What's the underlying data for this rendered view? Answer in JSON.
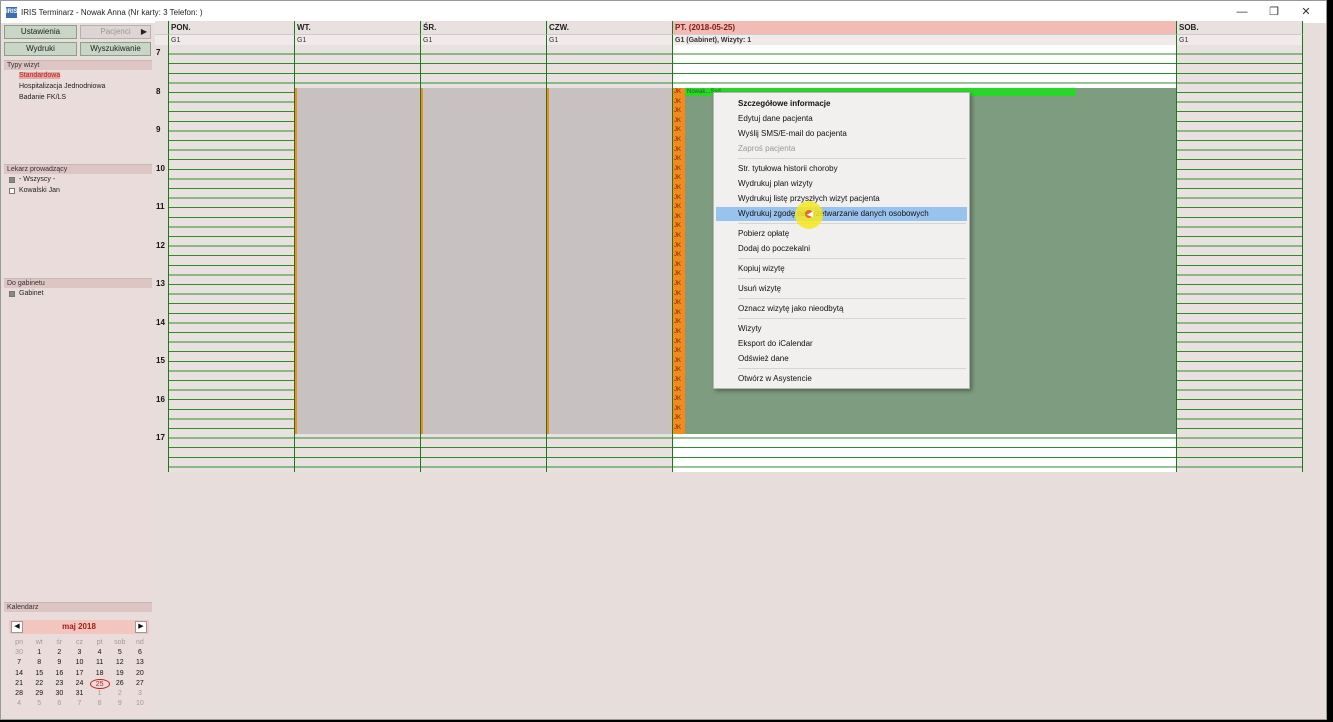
{
  "window": {
    "title": "IRIS Terminarz - Nowak Anna (Nr karty: 3  Telefon: )",
    "icon_text": "IRIS",
    "minimize_glyph": "—",
    "maximize_glyph": "❐",
    "close_glyph": "✕"
  },
  "toolbar": {
    "settings_label": "Ustawienia",
    "patients_label": "Pacjenci",
    "patients_arrow": "▶",
    "prints_label": "Wydruki",
    "search_label": "Wyszukiwanie"
  },
  "visit_types": {
    "header": "Typy wizyt",
    "items": [
      "Standardowa",
      "Hospitalizacja Jednodniowa",
      "Badanie FK/LS"
    ]
  },
  "doctors": {
    "header": "Lekarz prowadzący",
    "items": [
      "- Wszyscy -",
      "Kowalski Jan"
    ]
  },
  "offices": {
    "header": "Do gabinetu",
    "items": [
      "Gabinet"
    ]
  },
  "calendar": {
    "header": "Kalendarz",
    "month": "maj 2018",
    "prev": "◀",
    "next": "▶",
    "weekdays": [
      "pn",
      "wt",
      "śr",
      "cz",
      "pt",
      "sob",
      "nd"
    ],
    "weeks": [
      [
        "30",
        "1",
        "2",
        "3",
        "4",
        "5",
        "6"
      ],
      [
        "7",
        "8",
        "9",
        "10",
        "11",
        "12",
        "13"
      ],
      [
        "14",
        "15",
        "16",
        "17",
        "18",
        "19",
        "20"
      ],
      [
        "21",
        "22",
        "23",
        "24",
        "25",
        "26",
        "27"
      ],
      [
        "28",
        "29",
        "30",
        "31",
        "1",
        "2",
        "3"
      ],
      [
        "4",
        "5",
        "6",
        "7",
        "8",
        "9",
        "10"
      ]
    ],
    "today": "25"
  },
  "schedule": {
    "days": [
      {
        "head": "PON.",
        "sub": "G1"
      },
      {
        "head": "WT.",
        "sub": "G1"
      },
      {
        "head": "ŚR.",
        "sub": "G1"
      },
      {
        "head": "CZW.",
        "sub": "G1"
      },
      {
        "head": "PT. (2018-05-25)",
        "sub": "G1 (Gabinet), Wizyty: 1"
      },
      {
        "head": "SOB.",
        "sub": "G1"
      }
    ],
    "hours": [
      "7",
      "8",
      "9",
      "10",
      "11",
      "12",
      "13",
      "14",
      "15",
      "16",
      "17"
    ],
    "jk_label": "JK",
    "appointment_label": "Nowak...Ssd"
  },
  "context_menu": {
    "items": [
      {
        "label": "Szczegółowe informacje",
        "style": "bold"
      },
      {
        "label": "Edytuj dane pacjenta",
        "style": ""
      },
      {
        "label": "Wyślij SMS/E-mail do pacjenta",
        "style": ""
      },
      {
        "label": "Zaproś pacjenta",
        "style": "disabled"
      },
      {
        "label": "Str. tytułowa historii choroby",
        "style": ""
      },
      {
        "label": "Wydrukuj plan wizyty",
        "style": ""
      },
      {
        "label": "Wydrukuj listę przyszłych wizyt pacjenta",
        "style": ""
      },
      {
        "label": "Wydrukuj zgodę na przetwarzanie danych osobowych",
        "style": "hover"
      },
      {
        "label": "Pobierz opłatę",
        "style": ""
      },
      {
        "label": "Dodaj do poczekalni",
        "style": ""
      },
      {
        "label": "Kopiuj wizytę",
        "style": ""
      },
      {
        "label": "Usuń wizytę",
        "style": ""
      },
      {
        "label": "Oznacz wizytę jako nieodbytą",
        "style": ""
      },
      {
        "label": "Wizyty",
        "style": ""
      },
      {
        "label": "Eksport do iCalendar",
        "style": ""
      },
      {
        "label": "Odśwież dane",
        "style": ""
      },
      {
        "label": "Otwórz w Asystencie",
        "style": ""
      }
    ]
  },
  "colors": {
    "accent_red": "#b1231b",
    "grid_green": "#2e8b2e",
    "appointment_green": "#29d827",
    "jk_orange": "#f28a1c",
    "hover_blue": "#98c3ee"
  }
}
